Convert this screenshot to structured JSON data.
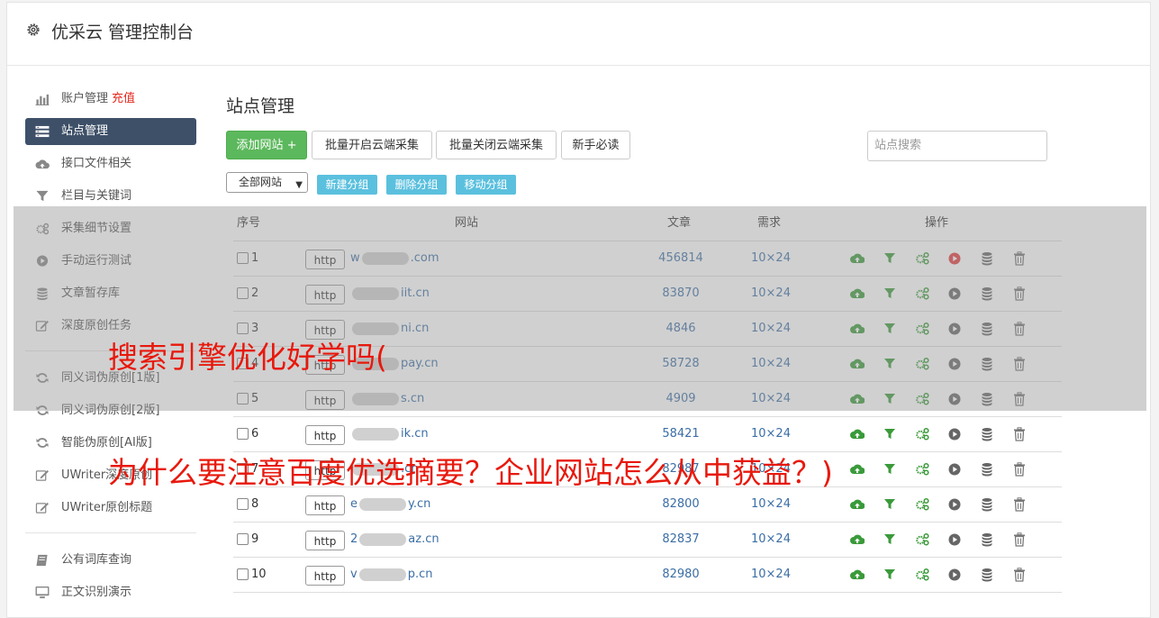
{
  "header": {
    "title": "优采云 管理控制台"
  },
  "sidebar": {
    "items": [
      {
        "label": "账户管理",
        "extra": "充值",
        "icon": "bar-chart-icon"
      },
      {
        "label": "站点管理",
        "icon": "list-icon",
        "active": true
      },
      {
        "label": "接口文件相关",
        "icon": "cloud-upload-icon"
      },
      {
        "label": "栏目与关键词",
        "icon": "filter-icon"
      },
      {
        "label": "采集细节设置",
        "icon": "gears-icon"
      },
      {
        "label": "手动运行测试",
        "icon": "play-circle-icon"
      },
      {
        "label": "文章暂存库",
        "icon": "database-icon"
      },
      {
        "label": "深度原创任务",
        "icon": "edit-icon"
      },
      {
        "label": "同义词伪原创[1版]",
        "icon": "refresh-icon"
      },
      {
        "label": "同义词伪原创[2版]",
        "icon": "refresh-icon"
      },
      {
        "label": "智能伪原创[AI版]",
        "icon": "refresh-icon"
      },
      {
        "label": "UWriter深度原创",
        "icon": "edit-icon"
      },
      {
        "label": "UWriter原创标题",
        "icon": "edit-icon"
      },
      {
        "label": "公有词库查询",
        "icon": "book-icon"
      },
      {
        "label": "正文识别演示",
        "icon": "monitor-icon"
      }
    ]
  },
  "main": {
    "title": "站点管理",
    "buttons": {
      "add_site": "添加网站 +",
      "batch_open": "批量开启云端采集",
      "batch_close": "批量关闭云端采集",
      "guide": "新手必读"
    },
    "search": {
      "placeholder": "站点搜索"
    },
    "group_select": "全部网站",
    "group_buttons": {
      "new": "新建分组",
      "delete": "删除分组",
      "move": "移动分组"
    },
    "table": {
      "headers": {
        "index": "序号",
        "site": "网站",
        "articles": "文章",
        "demand": "需求",
        "ops": "操作"
      },
      "rows": [
        {
          "index": "1",
          "scheme": "http",
          "site_prefix": "w",
          "site_suffix": ".com",
          "articles": "456814",
          "demand": "10×24",
          "play_active": true
        },
        {
          "index": "2",
          "scheme": "http",
          "site_prefix": "",
          "site_suffix": "iit.cn",
          "articles": "83870",
          "demand": "10×24",
          "play_active": false
        },
        {
          "index": "3",
          "scheme": "http",
          "site_prefix": "",
          "site_suffix": "ni.cn",
          "articles": "4846",
          "demand": "10×24",
          "play_active": false
        },
        {
          "index": "4",
          "scheme": "http",
          "site_prefix": "",
          "site_suffix": "pay.cn",
          "articles": "58728",
          "demand": "10×24",
          "play_active": false
        },
        {
          "index": "5",
          "scheme": "http",
          "site_prefix": "",
          "site_suffix": "s.cn",
          "articles": "4909",
          "demand": "10×24",
          "play_active": false
        },
        {
          "index": "6",
          "scheme": "http",
          "site_prefix": "",
          "site_suffix": "ik.cn",
          "articles": "58421",
          "demand": "10×24",
          "play_active": false
        },
        {
          "index": "7",
          "scheme": "http",
          "site_prefix": "",
          "site_suffix": ".cn",
          "articles": "82987",
          "demand": "10×24",
          "play_active": false
        },
        {
          "index": "8",
          "scheme": "http",
          "site_prefix": "e",
          "site_suffix": "y.cn",
          "articles": "82800",
          "demand": "10×24",
          "play_active": false
        },
        {
          "index": "9",
          "scheme": "http",
          "site_prefix": "2",
          "site_suffix": "az.cn",
          "articles": "82837",
          "demand": "10×24",
          "play_active": false
        },
        {
          "index": "10",
          "scheme": "http",
          "site_prefix": "v",
          "site_suffix": "p.cn",
          "articles": "82980",
          "demand": "10×24",
          "play_active": false
        }
      ]
    }
  },
  "overlay": {
    "line1": "搜索引擎优化好学吗(",
    "line2": "为什么要注意百度优选摘要？企业网站怎么从中获益？)"
  },
  "colors": {
    "accent_green": "#5cb85c",
    "accent_blue": "#5bc0de",
    "active_nav": "#3e5068",
    "link": "#3b6ea5",
    "overlay_text": "#e8180c",
    "recharge": "#e4271c",
    "play_active": "#e4393c"
  }
}
